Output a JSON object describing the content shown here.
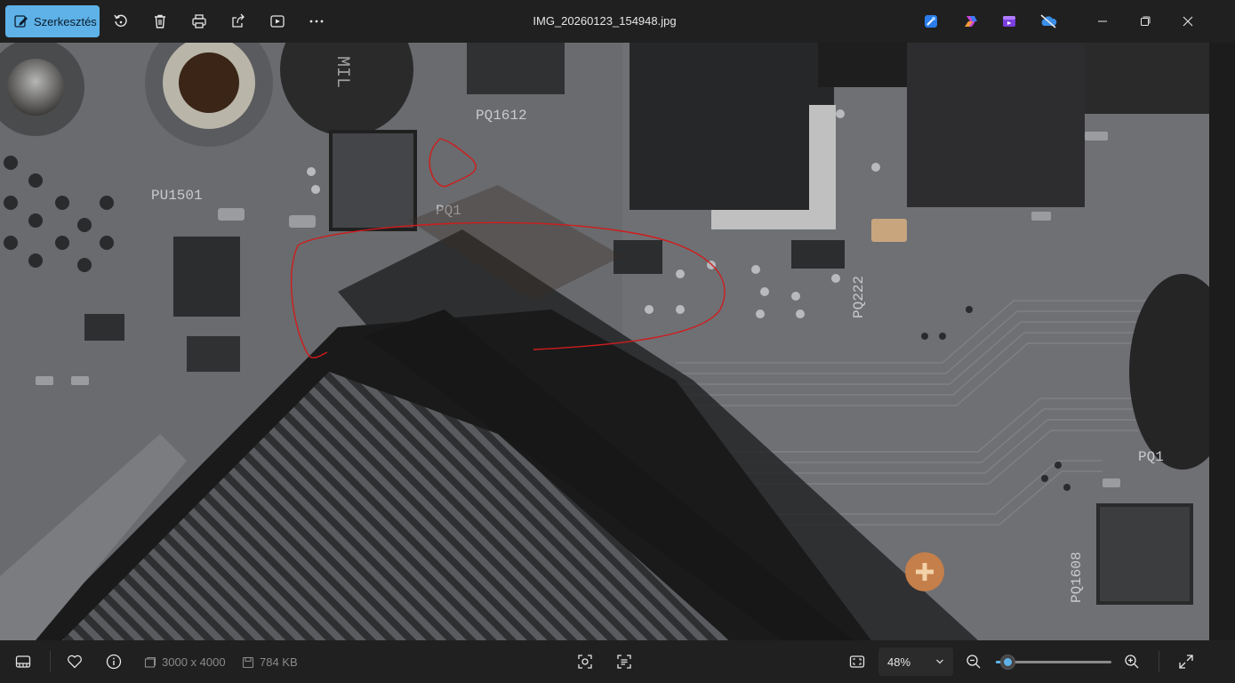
{
  "titlebar": {
    "edit_label": "Szerkesztés",
    "filename": "IMG_20260123_154948.jpg",
    "icons": [
      "edit-icon",
      "rotate-icon",
      "delete-icon",
      "print-icon",
      "share-icon",
      "slideshow-icon",
      "more-icon"
    ],
    "app_icons": [
      "designer-icon",
      "copilot-icon",
      "clipchamp-icon",
      "onedrive-icon"
    ],
    "window_controls": [
      "minimize-icon",
      "maximize-icon",
      "close-icon"
    ]
  },
  "image": {
    "labels": [
      "PU1501",
      "PQ1612",
      "PQ1",
      "PQ222",
      "PQ1608",
      "PQ1"
    ],
    "annotation_color": "#d01c1c"
  },
  "bottombar": {
    "dimensions": "3000 x 4000",
    "filesize": "784 KB",
    "zoom_value": "48%",
    "zoom_level": 0.1,
    "accent": "#5eb2e8"
  }
}
